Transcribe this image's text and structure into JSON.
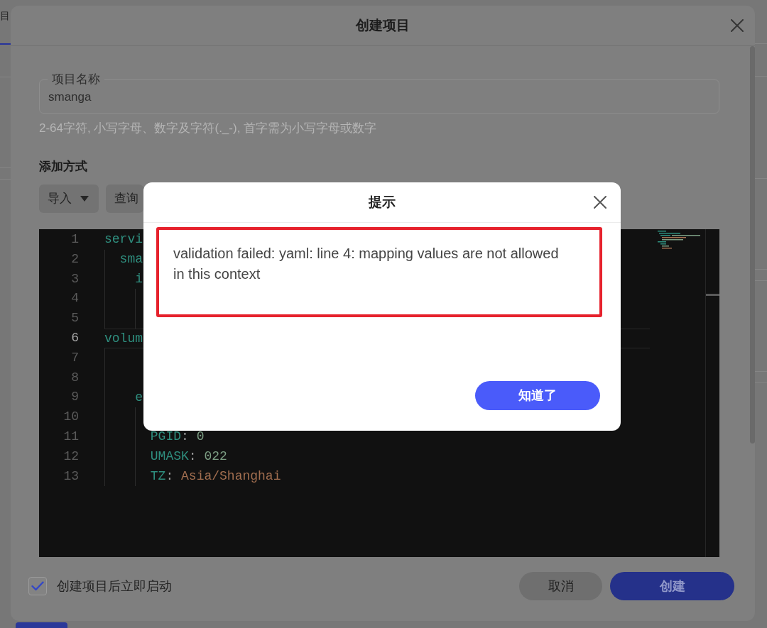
{
  "background_page": {
    "tab": {
      "label": "目",
      "selected": true
    }
  },
  "dialog": {
    "title": "创建项目",
    "name_field": {
      "label": "项目名称",
      "value": "smanga"
    },
    "hint": "2-64字符, 小写字母、数字及字符(._-), 首字需为小写字母或数字",
    "section_title": "添加方式",
    "toolbar": [
      {
        "label": "导入",
        "kind": "dropdown"
      },
      {
        "label": "查询",
        "kind": "button"
      }
    ],
    "editor": {
      "lines": [
        {
          "number": "1",
          "current": false,
          "tokens": [
            {
              "kind": "key",
              "text": "servi"
            }
          ]
        },
        {
          "number": "2",
          "current": false,
          "tokens": [
            {
              "kind": "key",
              "text": "  sma"
            }
          ]
        },
        {
          "number": "3",
          "current": false,
          "tokens": [
            {
              "kind": "key",
              "text": "    i"
            }
          ]
        },
        {
          "number": "4",
          "current": false
        },
        {
          "number": "5",
          "current": false
        },
        {
          "number": "6",
          "current": true,
          "tokens": [
            {
              "kind": "key",
              "text": "volum"
            }
          ]
        },
        {
          "number": "7",
          "current": false
        },
        {
          "number": "8",
          "current": false
        },
        {
          "number": "9",
          "current": false,
          "tokens": [
            {
              "kind": "key",
              "text": "    e"
            }
          ]
        },
        {
          "number": "10",
          "current": false
        },
        {
          "number": "11",
          "current": false,
          "tokens": [
            {
              "kind": "key",
              "text": "      PGID"
            },
            {
              "kind": "punct",
              "text": ": "
            },
            {
              "kind": "number",
              "text": "0"
            }
          ]
        },
        {
          "number": "12",
          "current": false,
          "tokens": [
            {
              "kind": "key",
              "text": "      UMASK"
            },
            {
              "kind": "punct",
              "text": ": "
            },
            {
              "kind": "number",
              "text": "022"
            }
          ]
        },
        {
          "number": "13",
          "current": false,
          "tokens": [
            {
              "kind": "key",
              "text": "      TZ"
            },
            {
              "kind": "punct",
              "text": ": "
            },
            {
              "kind": "string",
              "text": "Asia/Shanghai"
            }
          ]
        }
      ]
    },
    "auto_start": {
      "label": "创建项目后立即启动",
      "checked": true
    },
    "buttons": [
      {
        "label": "取消",
        "kind": "secondary"
      },
      {
        "label": "创建",
        "kind": "primary"
      }
    ]
  },
  "alert": {
    "title": "提示",
    "message": "validation failed: yaml: line 4: mapping values are not allowed in this context",
    "button": "知道了"
  }
}
